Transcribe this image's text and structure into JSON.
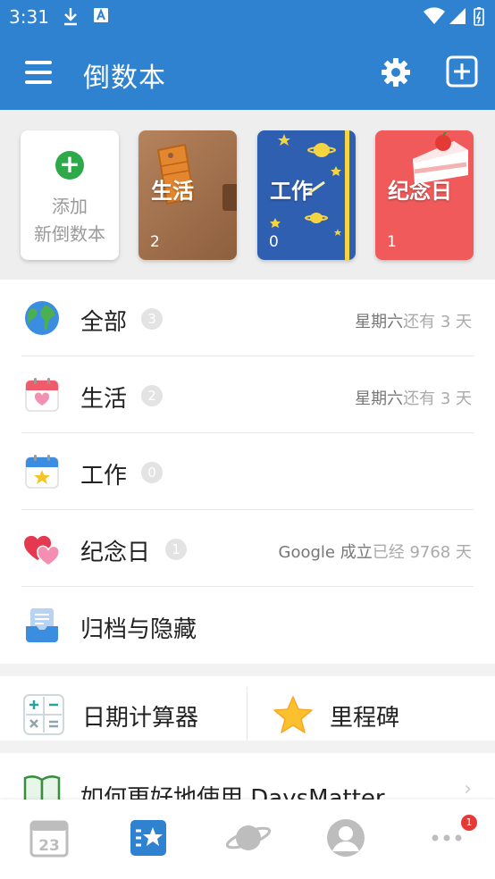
{
  "status_bar": {
    "time": "3:31"
  },
  "app_bar": {
    "title": "倒数本"
  },
  "categories": {
    "add_card": {
      "line1": "添加",
      "line2": "新倒数本"
    },
    "cards": [
      {
        "title": "生活",
        "count": "2"
      },
      {
        "title": "工作",
        "count": "0"
      },
      {
        "title": "纪念日",
        "count": "1"
      }
    ]
  },
  "list": {
    "rows": [
      {
        "name": "全部",
        "badge": "3",
        "info": "星期六",
        "info_suffix": "还有 3 天"
      },
      {
        "name": "生活",
        "badge": "2",
        "info": "星期六",
        "info_suffix": "还有 3 天"
      },
      {
        "name": "工作",
        "badge": "0",
        "info": "",
        "info_suffix": ""
      },
      {
        "name": "纪念日",
        "badge": "1",
        "info": "Google 成立",
        "info_suffix": "已经 9768 天"
      },
      {
        "name": "归档与隐藏"
      }
    ]
  },
  "tools": {
    "calculator": "日期计算器",
    "milestone": "里程碑"
  },
  "howto": {
    "text": "如何更好地使用 DaysMatter"
  },
  "bottom_nav": {
    "calendar_day": "23",
    "more_badge": "1"
  },
  "colors": {
    "primary": "#2f82d0",
    "green": "#2ea94a",
    "red": "#f05a5a"
  }
}
